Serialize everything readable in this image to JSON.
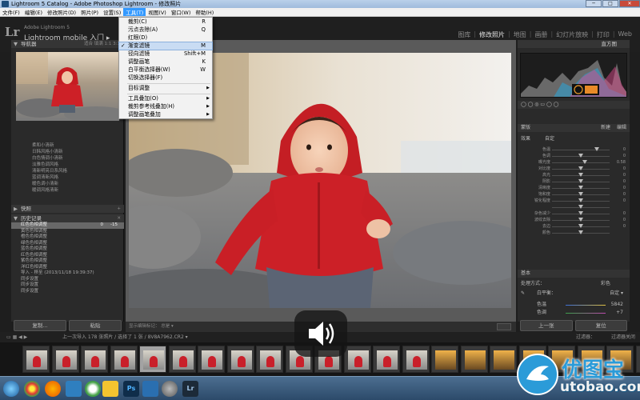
{
  "window": {
    "title": "Lightroom 5 Catalog - Adobe Photoshop Lightroom - 修改照片",
    "buttons": [
      "─",
      "□",
      "✕"
    ]
  },
  "menubar": {
    "items": [
      "文件(F)",
      "编辑(E)",
      "修改照片(D)",
      "照片(P)",
      "设置(S)",
      "工具(T)",
      "视图(V)",
      "窗口(W)",
      "帮助(H)"
    ],
    "active_index": 5
  },
  "identity": {
    "logo": "Lr",
    "subtitle": "Adobe Lightroom 5",
    "name": "Lightroom mobile 入门",
    "arrow": "▸"
  },
  "modules": [
    "图库",
    "修改照片",
    "地图",
    "画册",
    "幻灯片放映",
    "打印",
    "Web"
  ],
  "tools_menu": {
    "items": [
      {
        "label": "裁剪(C)",
        "shortcut": "R",
        "checked": false
      },
      {
        "label": "污点去除(A)",
        "shortcut": "Q",
        "checked": false
      },
      {
        "label": "红眼(D)",
        "shortcut": "",
        "checked": false
      },
      {
        "label": "渐变滤镜",
        "shortcut": "M",
        "checked": true
      },
      {
        "label": "径向滤镜",
        "shortcut": "Shift+M",
        "checked": false
      },
      {
        "label": "调整画笔",
        "shortcut": "K",
        "checked": false
      },
      {
        "label": "白平衡选择器(W)",
        "shortcut": "W",
        "checked": false
      },
      {
        "label": "切换选择器(F)",
        "shortcut": "",
        "checked": false
      }
    ],
    "group2": [
      {
        "label": "目标调整",
        "submenu": true
      }
    ],
    "group3": [
      {
        "label": "工具叠加(O)",
        "submenu": true
      },
      {
        "label": "裁剪参考线叠加(H)",
        "submenu": true
      },
      {
        "label": "调整画笔叠加",
        "submenu": true
      }
    ]
  },
  "left_panel": {
    "navigator_label": "导航器",
    "navigator_opts": "适合  填满  1:1  3:1",
    "presets": [
      "柔和小清新",
      "日韩风格小清新",
      "白色情调小清新",
      "淡雅色调风格",
      "清新明亮日系风格",
      "蓝调清新风格",
      "暖色调小清新",
      "暖调风格清新"
    ],
    "snapshot_label": "快照",
    "history_label": "历史记录",
    "history": [
      {
        "label": "红色色相调整",
        "a": "0",
        "b": "-15",
        "selected": true
      },
      {
        "label": "黄色色相调整",
        "a": "",
        "b": "",
        "selected": false
      },
      {
        "label": "橙色色相调整",
        "a": "",
        "b": "",
        "selected": false
      },
      {
        "label": "绿色色相调整",
        "a": "",
        "b": "",
        "selected": false
      },
      {
        "label": "蓝色色相调整",
        "a": "",
        "b": "",
        "selected": false
      },
      {
        "label": "红色色相调整",
        "a": "",
        "b": "",
        "selected": false
      },
      {
        "label": "紫色色相调整",
        "a": "",
        "b": "",
        "selected": false
      },
      {
        "label": "洋红色相调整",
        "a": "",
        "b": "",
        "selected": false
      },
      {
        "label": "导入 - 移至 (2013/11/18 19:39:37)",
        "a": "",
        "b": "",
        "selected": false
      },
      {
        "label": "同步设置",
        "a": "",
        "b": "",
        "selected": false
      },
      {
        "label": "同步设置",
        "a": "",
        "b": "",
        "selected": false
      },
      {
        "label": "同步设置",
        "a": "",
        "b": "",
        "selected": false
      }
    ],
    "copy_button": "复制...",
    "paste_button": "粘贴"
  },
  "toolbar": {
    "text": "显示编辑标记：  总是 ▾",
    "done": "完成"
  },
  "right_panel": {
    "histogram_label": "直方图",
    "mask_label": "蒙版",
    "new_label": "新建",
    "edit_label": "编辑",
    "effect_label": "效果",
    "custom_label": "自定",
    "sliders": [
      {
        "label": "色温",
        "pos": 0.78,
        "value": "0"
      },
      {
        "label": "色调",
        "pos": 0.5,
        "value": "0"
      },
      {
        "label": "曝光度",
        "pos": 0.57,
        "value": "0.58"
      },
      {
        "label": "对比度",
        "pos": 0.5,
        "value": "0"
      },
      {
        "label": "高光",
        "pos": 0.5,
        "value": "0"
      },
      {
        "label": "阴影",
        "pos": 0.5,
        "value": "0"
      },
      {
        "label": "清晰度",
        "pos": 0.5,
        "value": "0"
      },
      {
        "label": "饱和度",
        "pos": 0.5,
        "value": "0"
      },
      {
        "label": "锐化程度",
        "pos": 0.5,
        "value": "0"
      },
      {
        "label": "",
        "pos": 0.5,
        "value": ""
      },
      {
        "label": "杂色减少",
        "pos": 0.5,
        "value": "0"
      },
      {
        "label": "波纹去除",
        "pos": 0.5,
        "value": "0"
      },
      {
        "label": "去边",
        "pos": 0.5,
        "value": "0"
      },
      {
        "label": "颜色",
        "pos": 0.5,
        "value": ""
      }
    ],
    "basic_label": "基本",
    "treatment_label": "处理方式：",
    "color_label": "彩色",
    "wb_label": "白平衡：",
    "wb_value": "自定 ▾",
    "temp_label": "色温",
    "temp_value": "5842",
    "tint_label": "色调",
    "tint_value": "+7",
    "prev_button": "上一张",
    "reset_button": "复位"
  },
  "filmstrip": {
    "header": "上一次导入    178 张照片 / 选择了 1 张 / 8V8A7962.CR2 ▾",
    "filter_label": "过滤器：",
    "filter_value": "过滤器关闭",
    "selected_index": 4
  },
  "watermark": {
    "brand": "优图宝",
    "url": "utobao.com"
  },
  "colors": {
    "accent": "#3399ff",
    "hoodie_red": "#c41e24",
    "menu_bg": "#f2f2f2",
    "panel_bg": "#2a2a2a"
  }
}
